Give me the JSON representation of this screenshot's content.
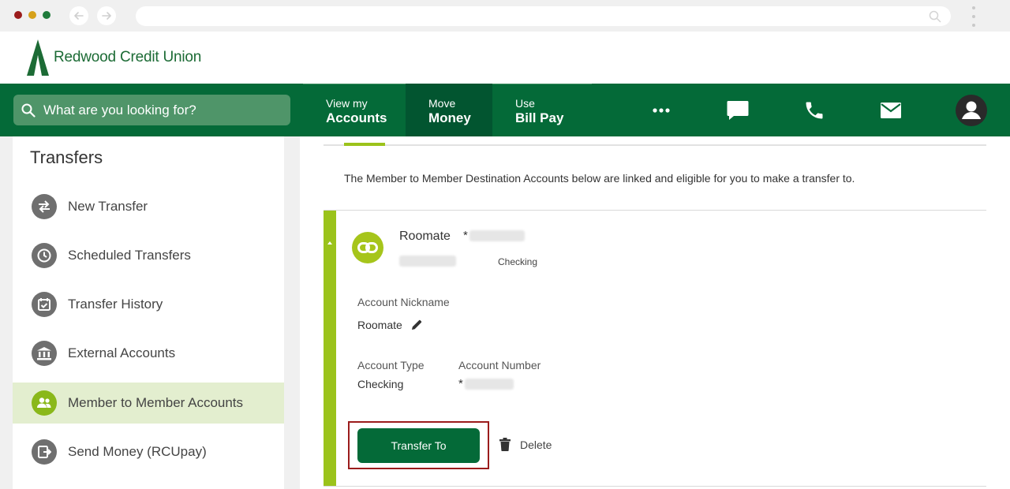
{
  "brand": {
    "name": "Redwood Credit Union",
    "green": "#046a38",
    "accent": "#9bc31b"
  },
  "search": {
    "placeholder": "What are you looking for?"
  },
  "nav": {
    "items": [
      {
        "small": "View my",
        "big": "Accounts"
      },
      {
        "small": "Move",
        "big": "Money"
      },
      {
        "small": "Use",
        "big": "Bill Pay"
      }
    ],
    "icons": [
      "more-icon",
      "chat-icon",
      "phone-icon",
      "mail-icon",
      "profile-icon"
    ]
  },
  "sidebar": {
    "title": "Transfers",
    "items": [
      {
        "label": "New Transfer",
        "icon": "swap-icon"
      },
      {
        "label": "Scheduled Transfers",
        "icon": "clock-icon"
      },
      {
        "label": "Transfer History",
        "icon": "calendar-check-icon"
      },
      {
        "label": "External Accounts",
        "icon": "bank-icon"
      },
      {
        "label": "Member to Member Accounts",
        "icon": "people-icon",
        "active": true
      },
      {
        "label": "Send Money (RCUpay)",
        "icon": "send-money-icon"
      }
    ]
  },
  "main": {
    "intro": "The Member to Member Destination Accounts below are linked and eligible for you to make a transfer to.",
    "account": {
      "name": "Roomate",
      "masked_prefix": "*",
      "type_small": "Checking",
      "nickname_label": "Account Nickname",
      "nickname_value": "Roomate",
      "type_label": "Account Type",
      "type_value": "Checking",
      "number_label": "Account Number",
      "number_prefix": "*"
    },
    "transfer_label": "Transfer To",
    "delete_label": "Delete"
  }
}
